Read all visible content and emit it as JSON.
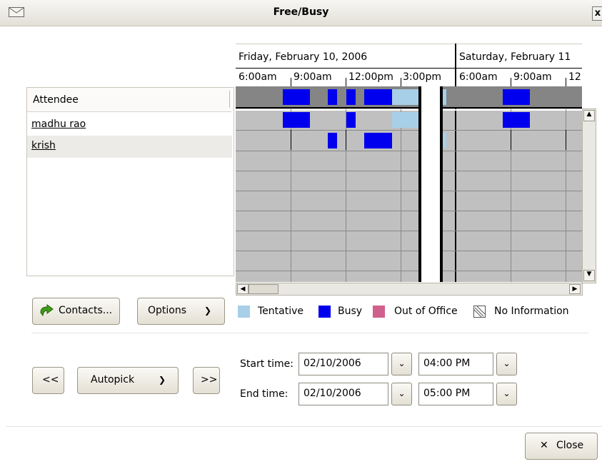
{
  "window": {
    "title": "Free/Busy",
    "close_glyph": "x"
  },
  "attendees": {
    "header": "Attendee",
    "rows": [
      {
        "name": "madhu rao"
      },
      {
        "name": "krish"
      }
    ]
  },
  "timeline": {
    "days": [
      "Friday, February 10, 2006",
      "Saturday, February 11"
    ],
    "hours_day1": [
      "6:00am",
      "9:00am",
      "12:00pm",
      "3:00pm"
    ],
    "hours_day2": [
      "6:00am",
      "9:00am",
      "12"
    ]
  },
  "buttons": {
    "contacts": "Contacts...",
    "options": "Options",
    "prev": "<<",
    "autopick": "Autopick",
    "next": ">>",
    "close": "Close"
  },
  "legend": {
    "tentative": "Tentative",
    "busy": "Busy",
    "out_of_office": "Out of Office",
    "no_information": "No Information"
  },
  "colors": {
    "tentative": "#a7cfe8",
    "busy": "#0000ee",
    "out_of_office": "#d0608e"
  },
  "form": {
    "start_label": "Start time:",
    "end_label": "End time:",
    "start_date": "02/10/2006",
    "start_time": "04:00 PM",
    "end_date": "02/10/2006",
    "end_time": "05:00 PM"
  },
  "icons": {
    "window": "envelope-icon",
    "contacts": "green-arrow-icon",
    "close": "x-mark-icon",
    "dropdown": "chevron-down-icon"
  }
}
